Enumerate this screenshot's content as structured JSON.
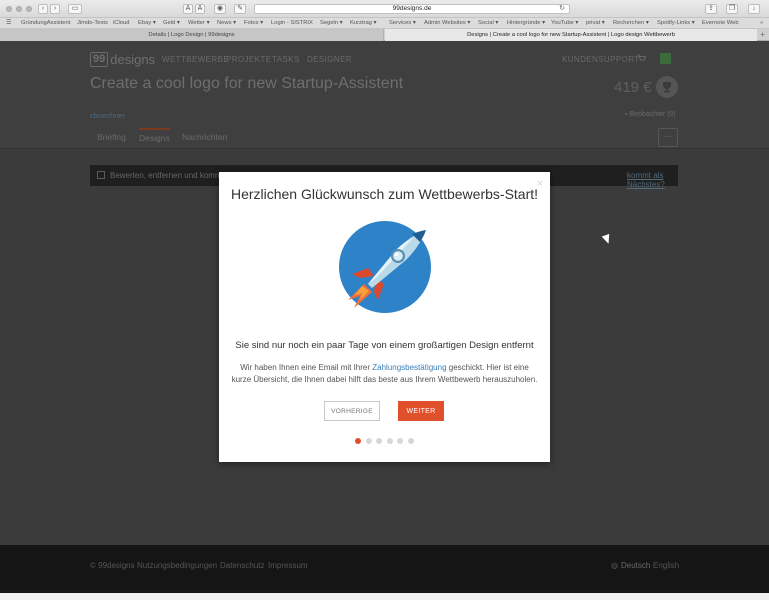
{
  "browser": {
    "url": "99designs.de",
    "bookmarks": [
      "GründungAssistent",
      "Jimdo-Tests",
      "iCloud",
      "Ebay ▾",
      "Geld ▾",
      "Wetter ▾",
      "News ▾",
      "Fotos ▾",
      "Login - SISTRIX",
      "Segeln ▾",
      "Kurztrag ▾",
      "Services ▾",
      "Admin Websites ▾",
      "Social ▾",
      "Hintergründe ▾",
      "YouTube ▾",
      "privat ▾",
      "Recherchen ▾",
      "Spotify-Links ▾",
      "Evernote Web"
    ],
    "tabs": [
      "Details | Logo Design | 99designs",
      "Designs | Create a cool logo for new Startup-Assistent | Logo design Wettbewerb"
    ]
  },
  "header": {
    "logo_box": "99",
    "logo_text": "designs",
    "nav": [
      "WETTBEWERBE",
      "PROJEKTE",
      "TASKS",
      "DESIGNER"
    ],
    "support": "KUNDENSUPPORT"
  },
  "contest": {
    "title": "Create a cool logo for new Startup-Assistent",
    "price": "419 €",
    "owner": "cbuechner",
    "watchers": "Beobachter (0)",
    "tabs": [
      "Briefing",
      "Designs",
      "Nachrichten"
    ],
    "active_tab": "Designs",
    "more": "···"
  },
  "banner": {
    "text": "Bewerten, entfernen und komm",
    "link": "kommt als Nächstes?"
  },
  "modal": {
    "close": "×",
    "title": "Herzlichen Glückwunsch zum Wettbewerbs-Start!",
    "subtitle": "Sie sind nur noch ein paar Tage von einem großartigen Design entfernt",
    "body_before": "Wir haben Ihnen eine Email mit Ihrer ",
    "body_link": "Zahlungsbestätigung",
    "body_after": " geschickt. Hier ist eine kurze Übersicht, die Ihnen dabei hilft das beste aus Ihrem Wettbewerb herauszuholen.",
    "prev_label": "VORHERIGE",
    "next_label": "WEITER",
    "dots_total": 6,
    "dots_active": 0
  },
  "footer": {
    "copyright": "© 99designs",
    "links": [
      "Nutzungsbedingungen",
      "Datenschutz",
      "Impressum"
    ],
    "lang_active": "Deutsch",
    "lang_other": "English"
  },
  "colors": {
    "accent": "#e0502a",
    "link": "#3a7fb6",
    "overlay_bg": "#3b3b3b"
  }
}
